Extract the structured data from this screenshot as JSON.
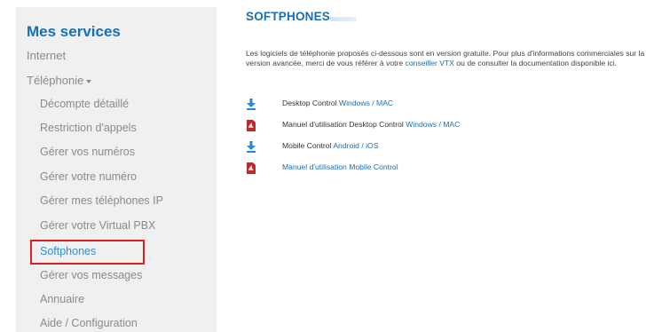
{
  "sidebar": {
    "title": "Mes services",
    "items": [
      {
        "label": "Internet",
        "level": "top",
        "active": false
      },
      {
        "label": "Téléphonie",
        "level": "top",
        "active": false,
        "has_caret": true
      },
      {
        "label": "Décompte détaillé",
        "level": "sub",
        "active": false
      },
      {
        "label": "Restriction d'appels",
        "level": "sub",
        "active": false
      },
      {
        "label": "Gérer vos numéros",
        "level": "sub",
        "active": false
      },
      {
        "label": "Gérer votre numéro",
        "level": "sub",
        "active": false
      },
      {
        "label": "Gérer mes téléphones IP",
        "level": "sub",
        "active": false
      },
      {
        "label": "Gérer votre Virtual PBX",
        "level": "sub",
        "active": false
      },
      {
        "label": "Softphones",
        "level": "sub",
        "active": true
      },
      {
        "label": "Gérer vos messages",
        "level": "sub",
        "active": false
      },
      {
        "label": "Annuaire",
        "level": "sub",
        "active": false
      },
      {
        "label": "Aide / Configuration",
        "level": "sub",
        "active": false
      }
    ]
  },
  "main": {
    "title": "SOFTPHONES",
    "intro_part1": "Les logiciels de téléphonie proposés ci-dessous sont en version gratuite. Pour plus d'informations commerciales sur la version avancée, merci de vous référer à votre ",
    "intro_link": "conseiller VTX",
    "intro_part2": " ou de consulter la documentation disponible ici.",
    "downloads": [
      {
        "icon": "download-icon",
        "prefix": "Desktop Control ",
        "link": "Windows / MAC"
      },
      {
        "icon": "pdf-icon",
        "prefix": "Manuel d'utilisation Desktop Control ",
        "link": "Windows / MAC"
      },
      {
        "icon": "download-icon",
        "prefix": "Mobile Control ",
        "link": "Android / iOS"
      },
      {
        "icon": "pdf-icon",
        "prefix": "",
        "link": "Manuel d'utilisation Mobile Control"
      }
    ]
  },
  "colors": {
    "accent": "#1a6fb0",
    "active_item": "#2e8fd6",
    "highlight": "#e02020",
    "sidebar_bg": "#f0f0f0",
    "pdf_red": "#c0282c"
  }
}
